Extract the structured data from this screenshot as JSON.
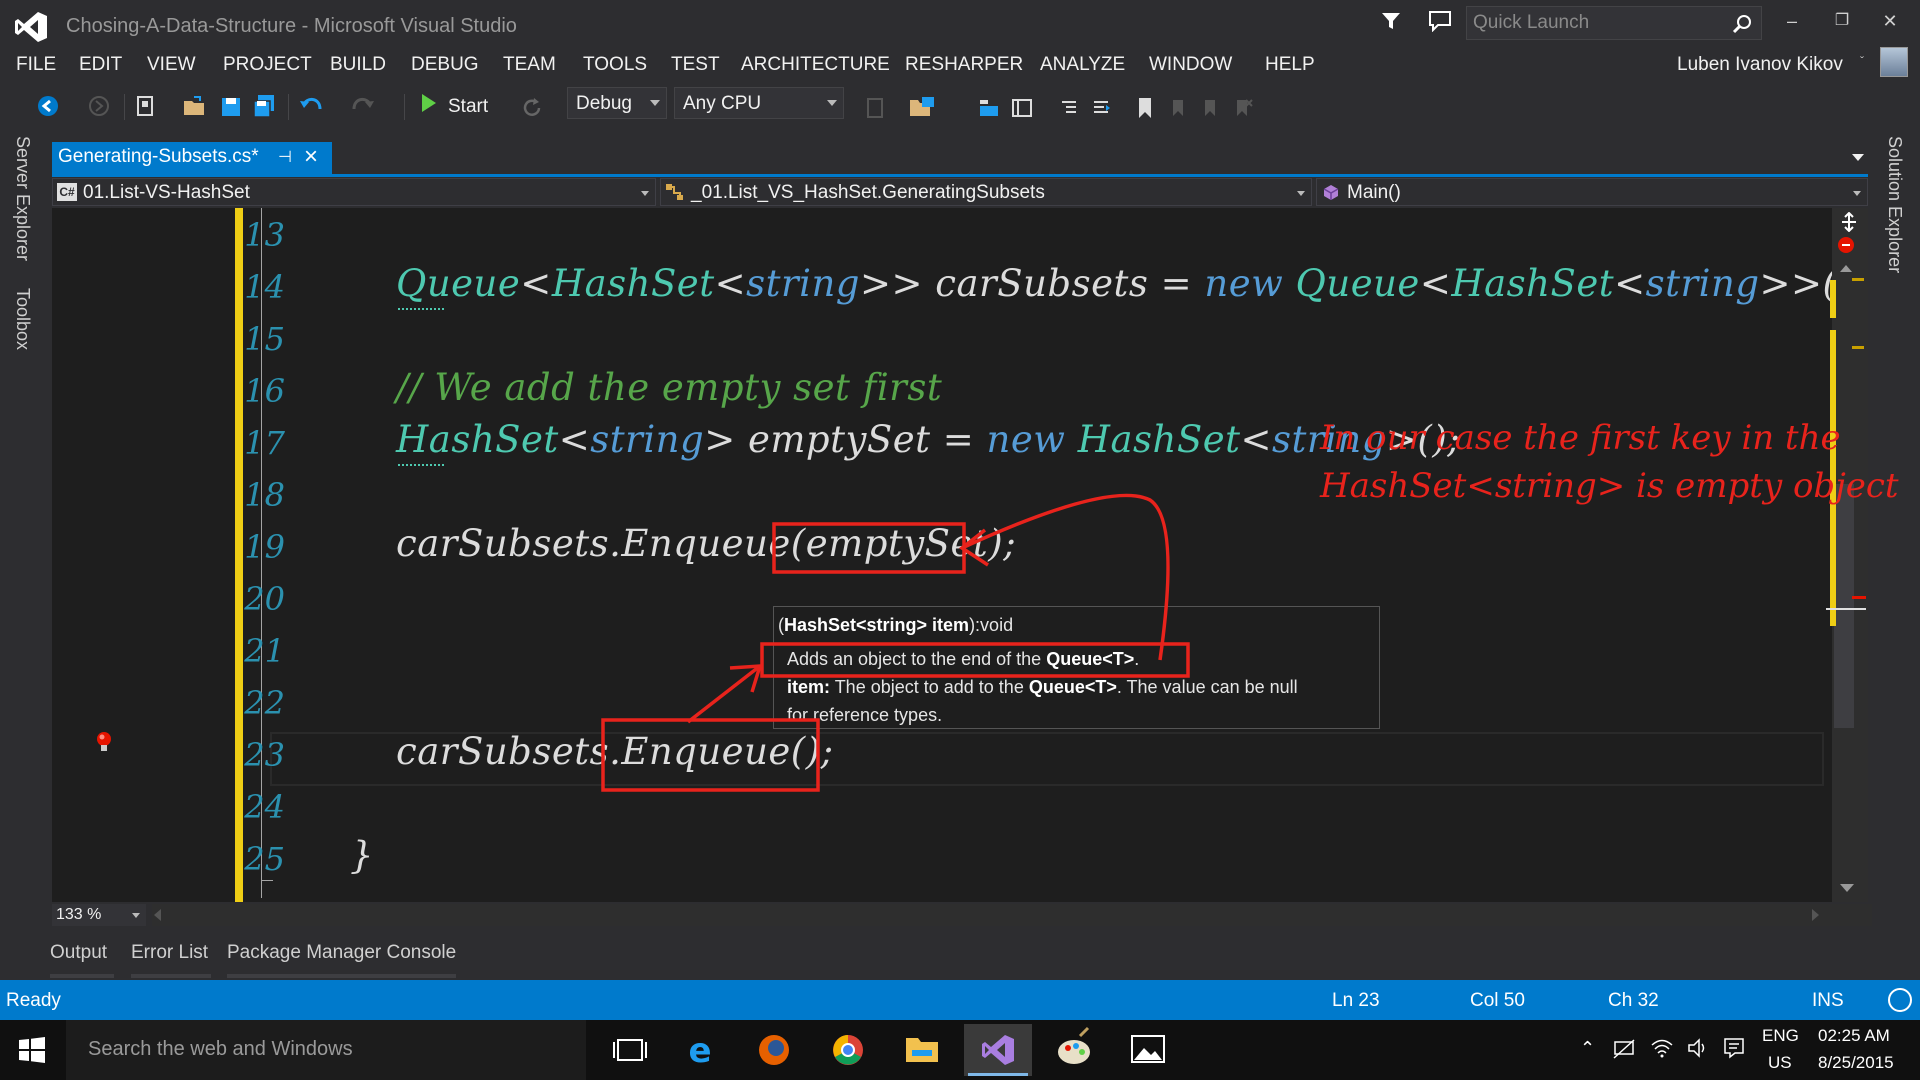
{
  "window": {
    "title": "Chosing-A-Data-Structure - Microsoft Visual Studio",
    "quick_launch_placeholder": "Quick Launch",
    "min": "–",
    "max": "❐",
    "close": "✕"
  },
  "menu": [
    "FILE",
    "EDIT",
    "VIEW",
    "PROJECT",
    "BUILD",
    "DEBUG",
    "TEAM",
    "TOOLS",
    "TEST",
    "ARCHITECTURE",
    "RESHARPER",
    "ANALYZE",
    "WINDOW",
    "HELP"
  ],
  "user": {
    "name": "Luben Ivanov Kikov",
    "caret": "ˇ"
  },
  "toolbar": {
    "start_label": "Start",
    "config": "Debug",
    "platform": "Any CPU"
  },
  "side_panels": {
    "left": [
      "Server Explorer",
      "Toolbox"
    ],
    "right": [
      "Solution Explorer"
    ]
  },
  "doc_tab": {
    "label": "Generating-Subsets.cs*",
    "pin": "⊣",
    "close": "×"
  },
  "navbar": {
    "project": "01.List-VS-HashSet",
    "class": "_01.List_VS_HashSet.GeneratingSubsets",
    "member": "Main()",
    "project_icon": "C#"
  },
  "editor": {
    "line_numbers": [
      "13",
      "14",
      "15",
      "16",
      "17",
      "18",
      "19",
      "20",
      "21",
      "22",
      "23",
      "24",
      "25"
    ],
    "line14": {
      "t1": "Queue",
      "p1": "<",
      "t2": "HashSet",
      "p2": "<",
      "k1": "string",
      "p3": ">> carSubsets = ",
      "k2": "new",
      "sp": " ",
      "t3": "Queue",
      "p4": "<",
      "t4": "HashSet",
      "p5": "<",
      "k3": "string",
      "p6": ">>();"
    },
    "line16": "// We add the empty set first",
    "line17": {
      "t1": "HashSet",
      "p1": "<",
      "k1": "string",
      "p2": "> emptySet = ",
      "k2": "new",
      "sp": " ",
      "t2": "HashSet",
      "p3": "<",
      "k3": "string",
      "p4": ">();"
    },
    "line19": "carSubsets.Enqueue(emptySet);",
    "line23": "carSubsets.Enqueue();",
    "line25": "}"
  },
  "tooltip": {
    "sig_bold": "HashSet<string> item",
    "sig_open": "(",
    "sig_rest": "):void",
    "desc_pre": "Adds an object to the end of the ",
    "desc_bold": "Queue<T>",
    "desc_post": ".",
    "param_name": "item:",
    "param_pre": " The object to add to the ",
    "param_bold": "Queue<T>",
    "param_post": ". The value can be null",
    "param_line2": "for reference types."
  },
  "annotation": {
    "line1": "In our case the first key in the",
    "line2": "HashSet<string> is empty object",
    "color": "#e8231c"
  },
  "zoom": "133 %",
  "bottom_tabs": [
    "Output",
    "Error List",
    "Package Manager Console"
  ],
  "status": {
    "ready": "Ready",
    "ln": "Ln 23",
    "col": "Col 50",
    "ch": "Ch 32",
    "mode": "INS"
  },
  "taskbar": {
    "search_placeholder": "Search the web and Windows",
    "lang1": "ENG",
    "lang2": "US",
    "time": "02:25 AM",
    "date": "8/25/2015"
  },
  "colors": {
    "accent": "#007acc",
    "keyword": "#569cd6",
    "type": "#4ec9b0",
    "comment": "#57a64a",
    "change_bar": "#efce15"
  }
}
